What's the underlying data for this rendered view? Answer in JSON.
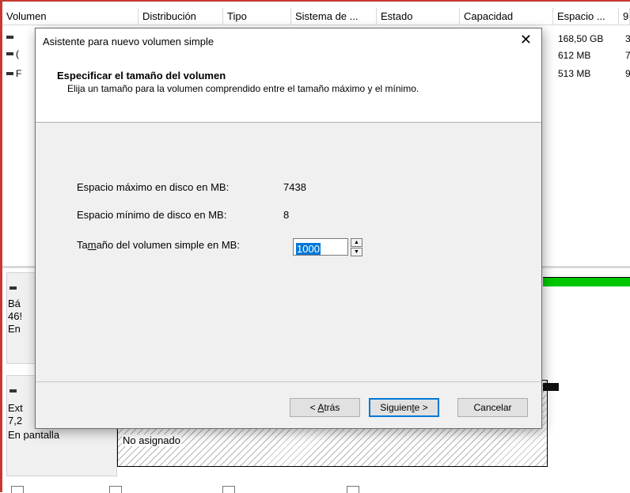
{
  "columns": [
    "Volumen",
    "Distribución",
    "Tipo",
    "Sistema de ...",
    "Estado",
    "Capacidad",
    "Espacio ...",
    "9"
  ],
  "volume_rows": [
    {
      "name_frag": "",
      "space": "168,50 GB",
      "extra": "3"
    },
    {
      "name_frag": "(",
      "space": "612 MB",
      "extra": "7"
    },
    {
      "name_frag": "F",
      "space": "513 MB",
      "extra": "9"
    }
  ],
  "disk0": {
    "l1": "Bá",
    "l2": "46!",
    "l3": "En"
  },
  "disk1": {
    "l1": "Ext",
    "l2": "7,2",
    "l3": "En pantalla"
  },
  "unallocated_label": "No asignado",
  "dialog": {
    "title": "Asistente para nuevo volumen simple",
    "close": "✕",
    "heading": "Especificar el tamaño del volumen",
    "subheading": "Elija un tamaño para la volumen comprendido entre el tamaño máximo y el mínimo.",
    "max_label": "Espacio máximo en disco en MB:",
    "max_value": "7438",
    "min_label": "Espacio mínimo de disco en MB:",
    "min_value": "8",
    "size_label_pre": "Ta",
    "size_label_u": "m",
    "size_label_post": "año del volumen simple en MB:",
    "size_value": "1000",
    "back_pre": "< ",
    "back_u": "A",
    "back_post": "trás",
    "next_pre": "Siguien",
    "next_u": "t",
    "next_post": "e >",
    "cancel": "Cancelar"
  },
  "colors": {
    "accent": "#0078d7",
    "green": "#00c800",
    "border_red": "#c43a31"
  }
}
